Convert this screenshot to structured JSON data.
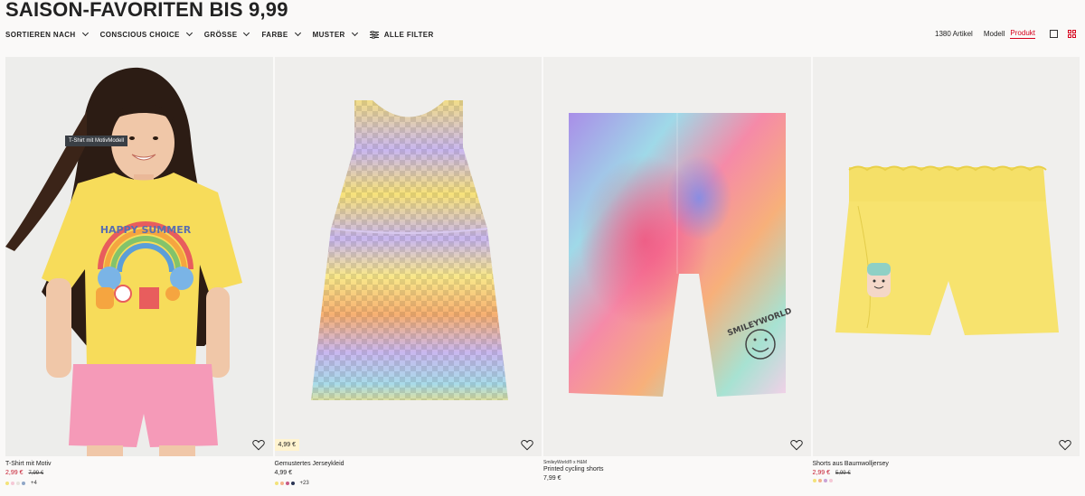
{
  "page": {
    "title": "SAISON-FAVORITEN BIS 9,99"
  },
  "filters": [
    {
      "label": "SORTIEREN NACH"
    },
    {
      "label": "CONSCIOUS CHOICE"
    },
    {
      "label": "GRÖSSE"
    },
    {
      "label": "FARBE"
    },
    {
      "label": "MUSTER"
    }
  ],
  "all_filters_label": "ALLE FILTER",
  "toolbar": {
    "count": "1380 Artikel",
    "view_model": "Modell",
    "view_product": "Produkt"
  },
  "products": [
    {
      "brand": "",
      "name": "T-Shirt mit Motiv",
      "price": "2,99 €",
      "old_price": "7,99 €",
      "on_sale": true,
      "tooltip": "T-Shirt mit MotivModell",
      "badge": "",
      "swatches": [
        "#f3e27a",
        "#f5c8d6",
        "#e7e2dc",
        "#8fa6c7"
      ],
      "more": "+4",
      "image_bg": "#eeedeb"
    },
    {
      "brand": "",
      "name": "Gemustertes Jerseykleid",
      "price": "4,99 €",
      "old_price": "",
      "on_sale": false,
      "tooltip": "",
      "badge": "4,99 €",
      "swatches": [
        "#f3e27a",
        "#f5b28a",
        "#c95a84",
        "#2a3454"
      ],
      "more": "+23",
      "image_bg": "#efeeec"
    },
    {
      "brand": "SmileyWorld® x H&M",
      "name": "Printed cycling shorts",
      "price": "7,99 €",
      "old_price": "",
      "on_sale": false,
      "tooltip": "",
      "badge": "",
      "swatches": [],
      "more": "",
      "image_bg": "#f0efed"
    },
    {
      "brand": "",
      "name": "Shorts aus Baumwolljersey",
      "price": "2,99 €",
      "old_price": "5,99 €",
      "on_sale": true,
      "tooltip": "",
      "badge": "",
      "swatches": [
        "#f3e27a",
        "#f5b28a",
        "#c9a3d6",
        "#f5c8d6"
      ],
      "more": "",
      "image_bg": "#f0efed"
    }
  ]
}
